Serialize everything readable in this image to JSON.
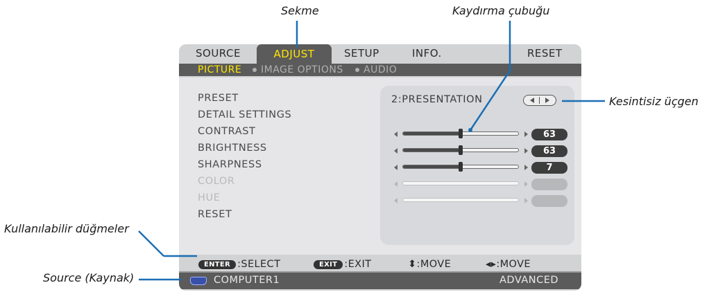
{
  "callouts": {
    "tab": "Sekme",
    "scrollbar": "Kaydırma çubuğu",
    "triangle": "Kesintisiz üçgen",
    "buttons": "Kullanılabilir düğmeler",
    "source": "Source (Kaynak)"
  },
  "tabs": [
    "SOURCE",
    "ADJUST",
    "SETUP",
    "INFO.",
    "RESET"
  ],
  "active_tab": "ADJUST",
  "subtabs": [
    "PICTURE",
    "IMAGE OPTIONS",
    "AUDIO"
  ],
  "active_subtab": "PICTURE",
  "menu": {
    "preset": {
      "label": "PRESET",
      "value": "2:PRESENTATION"
    },
    "detail": {
      "label": "DETAIL SETTINGS"
    },
    "contrast": {
      "label": "CONTRAST",
      "value": "63",
      "level": 0.5
    },
    "brightness": {
      "label": "BRIGHTNESS",
      "value": "63",
      "level": 0.5
    },
    "sharpness": {
      "label": "SHARPNESS",
      "value": "7",
      "level": 0.5
    },
    "color": {
      "label": "COLOR",
      "value": "",
      "disabled": true
    },
    "hue": {
      "label": "HUE",
      "value": "",
      "disabled": true
    },
    "reset": {
      "label": "RESET"
    }
  },
  "footer": {
    "enter_key": "ENTER",
    "enter_action": ":SELECT",
    "exit_key": "EXIT",
    "exit_action": ":EXIT",
    "move_ud": "⬍:MOVE",
    "move_lr": "◂▸:MOVE"
  },
  "source": {
    "name": "COMPUTER1",
    "mode": "ADVANCED"
  },
  "colors": {
    "highlight": "#ffe600",
    "bar": "#5b5b5b",
    "panel": "#d2d3d5",
    "callout_line": "#1b6fb5"
  }
}
